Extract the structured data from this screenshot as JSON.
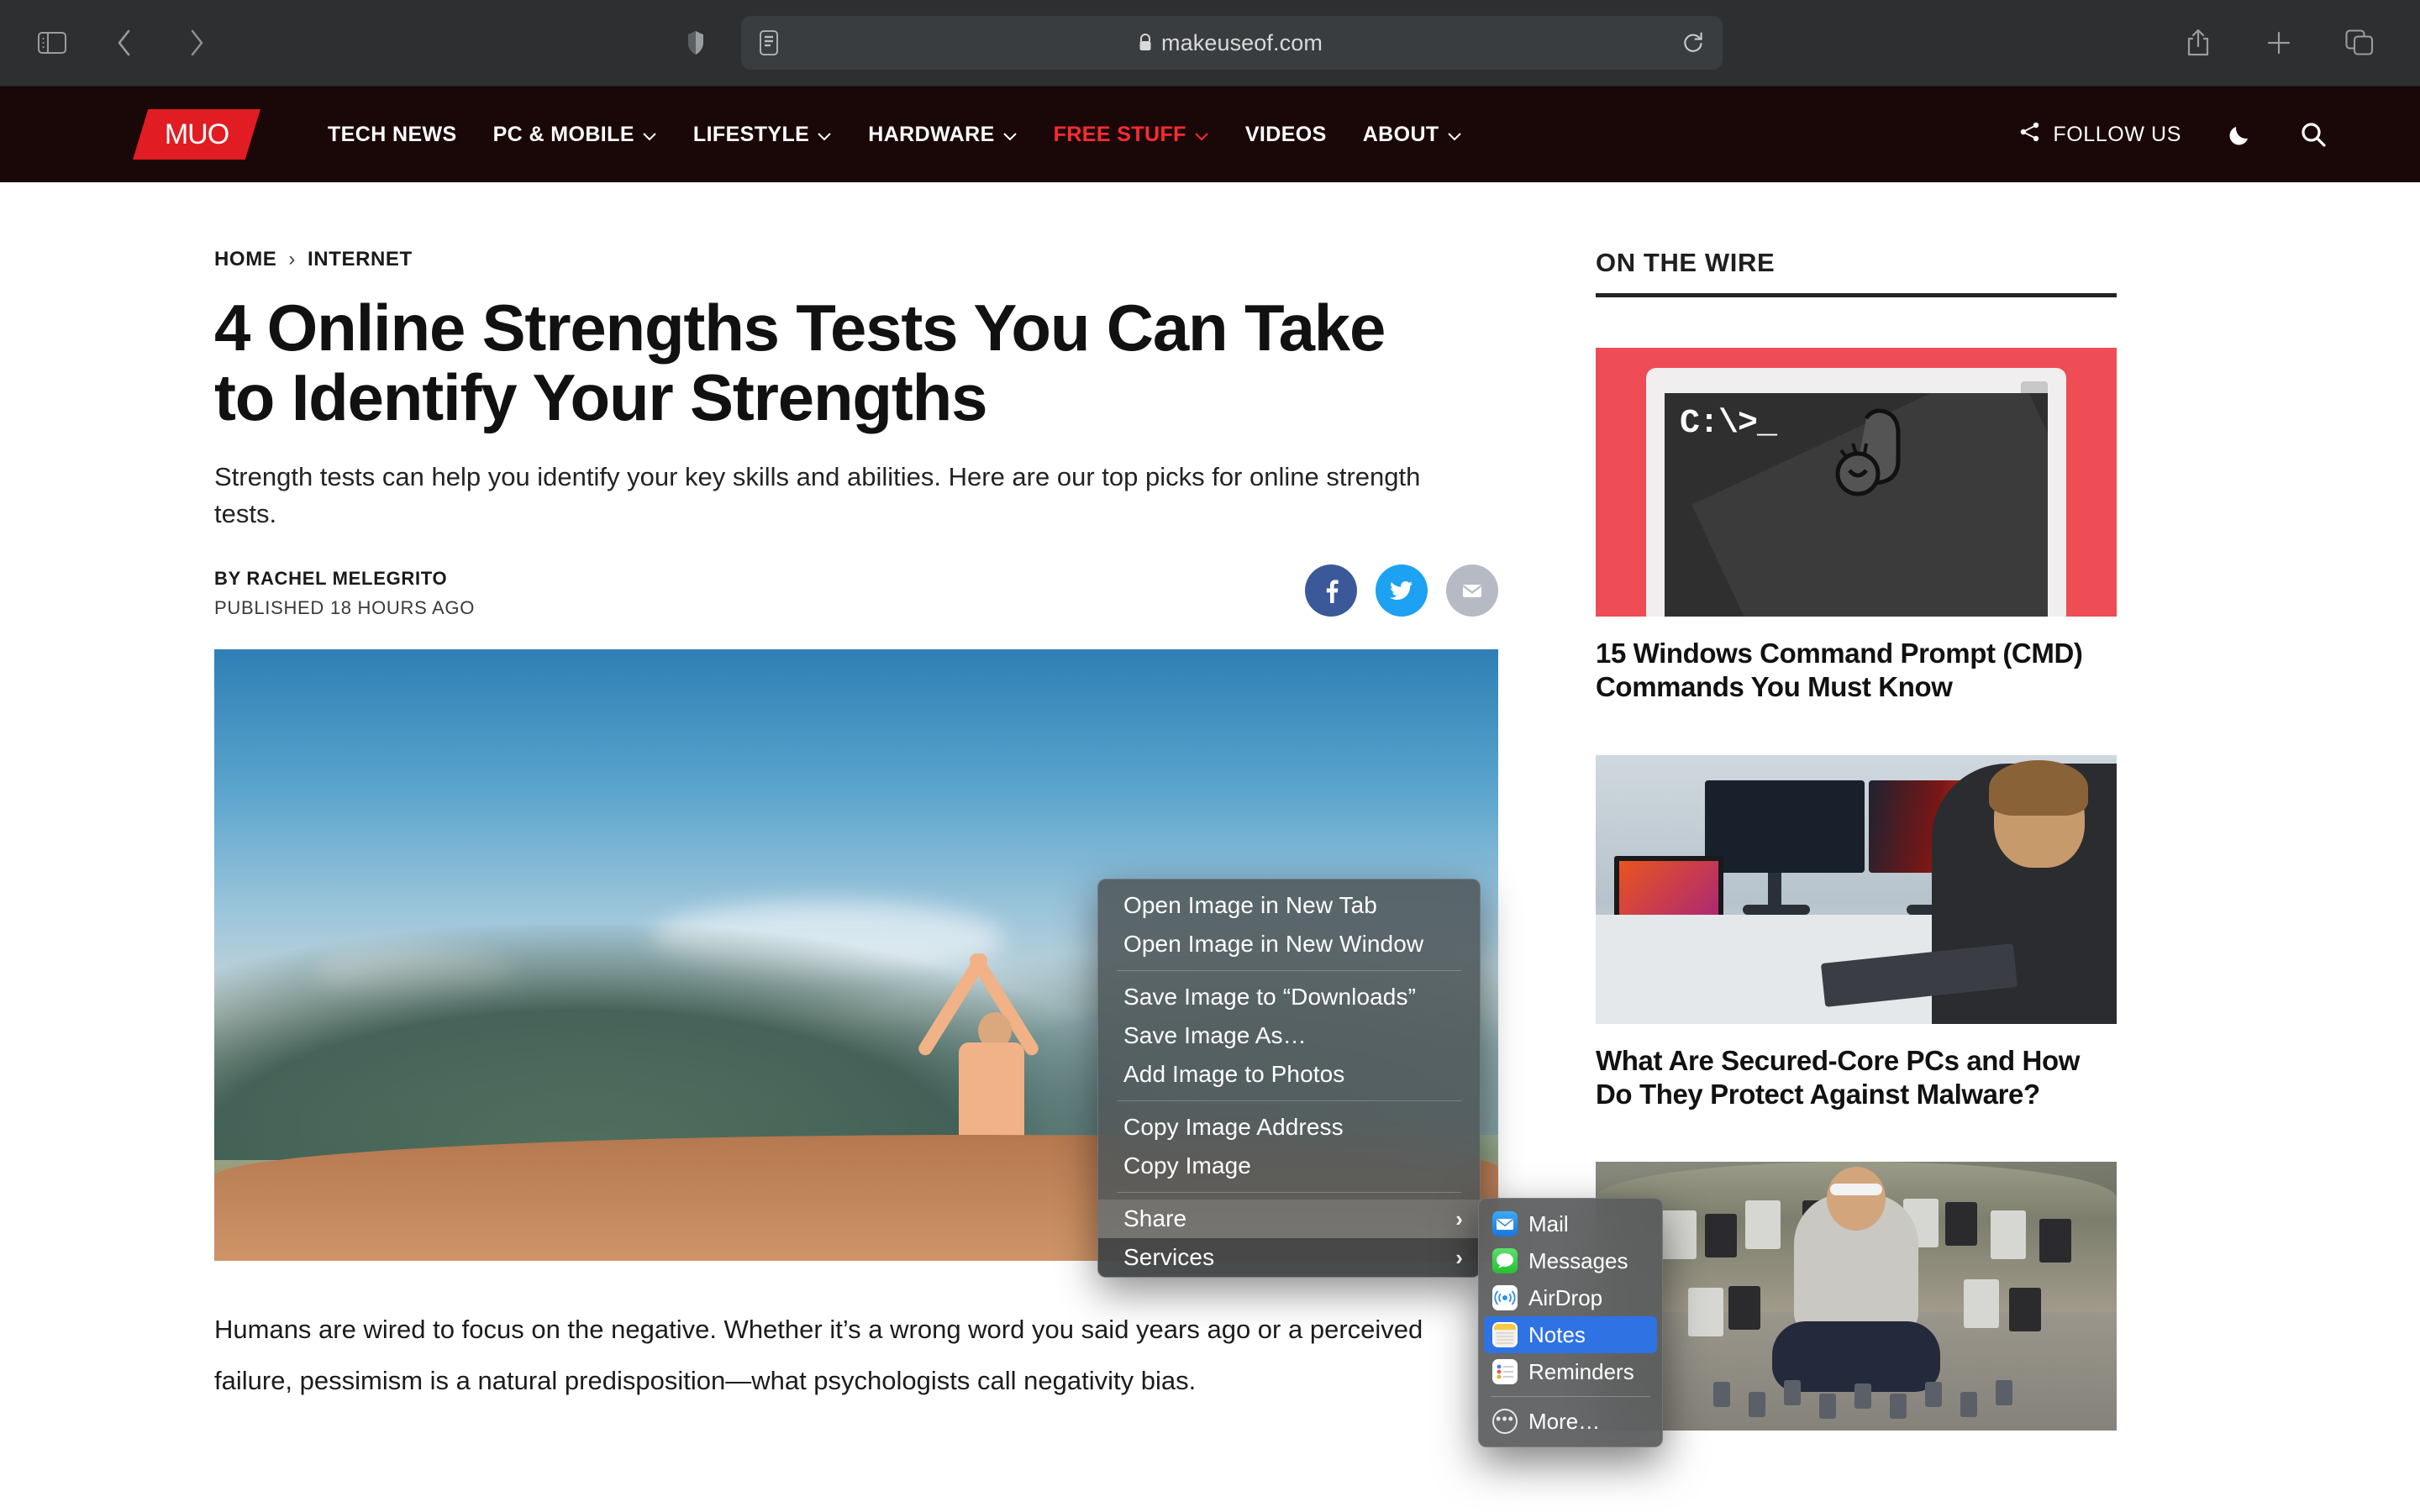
{
  "browser": {
    "url": "makeuseof.com",
    "lock_icon": "lock-icon",
    "sidebar_icon": "sidebar-toggle-icon",
    "back_icon": "back-arrow-icon",
    "forward_icon": "forward-arrow-icon",
    "shield_icon": "privacy-shield-icon",
    "reader_icon": "reader-view-icon",
    "reload_icon": "reload-icon",
    "share_icon": "share-icon",
    "newtab_icon": "plus-new-tab-icon",
    "tabs_icon": "tab-overview-icon"
  },
  "header": {
    "logo_text": "MUO",
    "nav": [
      {
        "label": "TECH NEWS",
        "caret": false,
        "accent": false
      },
      {
        "label": "PC & MOBILE",
        "caret": true,
        "accent": false
      },
      {
        "label": "LIFESTYLE",
        "caret": true,
        "accent": false
      },
      {
        "label": "HARDWARE",
        "caret": true,
        "accent": false
      },
      {
        "label": "FREE STUFF",
        "caret": true,
        "accent": true
      },
      {
        "label": "VIDEOS",
        "caret": false,
        "accent": false
      },
      {
        "label": "ABOUT",
        "caret": true,
        "accent": false
      }
    ],
    "follow_us": "FOLLOW US",
    "accent_color": "#ff2b32",
    "bg_color": "#1a0707",
    "logo_color": "#e11c22"
  },
  "article": {
    "breadcrumb": {
      "home": "HOME",
      "separator": "›",
      "section": "INTERNET"
    },
    "headline": "4 Online Strengths Tests You Can Take to Identify Your Strengths",
    "dek": "Strength tests can help you identify your key skills and abilities. Here are our top picks for online strength tests.",
    "author": "BY RACHEL MELEGRITO",
    "published": "PUBLISHED 18 HOURS AGO",
    "share_buttons": [
      {
        "name": "facebook",
        "glyph": "f",
        "color": "#3b5998"
      },
      {
        "name": "twitter",
        "glyph": "",
        "color": "#1da1f2"
      },
      {
        "name": "email",
        "glyph": "",
        "color": "#b6bac4"
      }
    ],
    "body": "Humans are wired to focus on the negative. Whether it’s a wrong word you said years ago or a perceived failure, pessimism is a natural predisposition—what psychologists call negativity bias."
  },
  "sidebar": {
    "title": "ON THE WIRE",
    "cards": [
      {
        "caption": "15 Windows Command Prompt (CMD) Commands You Must Know",
        "thumb": "cmd-prompt-thumbnail",
        "cmd_text": "C:\\>_"
      },
      {
        "caption": "What Are Secured-Core PCs and How Do They Protect Against Malware?",
        "thumb": "secured-core-pc-thumbnail"
      },
      {
        "caption": "",
        "thumb": "gadgets-man-thumbnail"
      }
    ]
  },
  "context_menu": {
    "groups": [
      [
        {
          "label": "Open Image in New Tab",
          "submenu": false,
          "state": "normal"
        },
        {
          "label": "Open Image in New Window",
          "submenu": false,
          "state": "normal"
        }
      ],
      [
        {
          "label": "Save Image to “Downloads”",
          "submenu": false,
          "state": "normal"
        },
        {
          "label": "Save Image As…",
          "submenu": false,
          "state": "normal"
        },
        {
          "label": "Add Image to Photos",
          "submenu": false,
          "state": "normal"
        }
      ],
      [
        {
          "label": "Copy Image Address",
          "submenu": false,
          "state": "normal"
        },
        {
          "label": "Copy Image",
          "submenu": false,
          "state": "normal"
        }
      ],
      [
        {
          "label": "Share",
          "submenu": true,
          "state": "selected",
          "chevron": "›"
        },
        {
          "label": "Services",
          "submenu": true,
          "state": "dim",
          "chevron": "›"
        }
      ]
    ]
  },
  "share_menu": {
    "items": [
      {
        "label": "Mail",
        "icon": "mail-icon",
        "selected": false
      },
      {
        "label": "Messages",
        "icon": "messages-icon",
        "selected": false
      },
      {
        "label": "AirDrop",
        "icon": "airdrop-icon",
        "selected": false
      },
      {
        "label": "Notes",
        "icon": "notes-icon",
        "selected": true
      },
      {
        "label": "Reminders",
        "icon": "reminders-icon",
        "selected": false
      }
    ],
    "more": {
      "label": "More…",
      "icon": "more-ellipsis-icon"
    },
    "highlight_color": "#2f72e3"
  }
}
